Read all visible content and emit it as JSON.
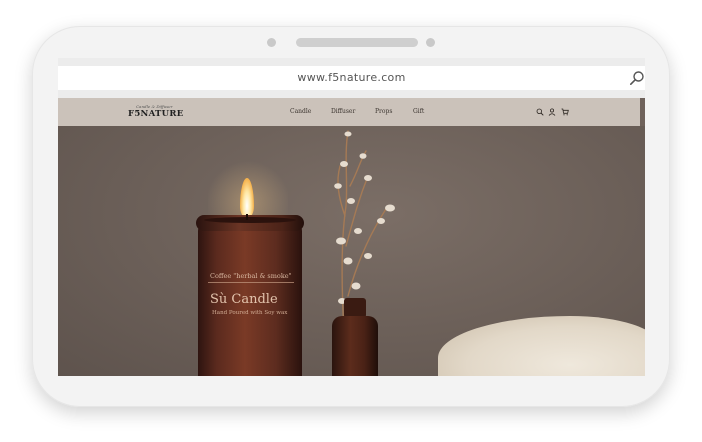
{
  "browser": {
    "url": "www.f5nature.com"
  },
  "site": {
    "logo": {
      "tagline": "Candle & Diffuser",
      "name": "F5NATURE"
    },
    "menu": [
      {
        "label": "Candle"
      },
      {
        "label": "Diffuser"
      },
      {
        "label": "Props"
      },
      {
        "label": "Gift"
      }
    ],
    "icons": [
      "search-icon",
      "user-icon",
      "cart-icon"
    ]
  },
  "hero": {
    "jar_label": {
      "subtitle": "Coffee \"herbal & smoke\"",
      "name": "Sù Candle",
      "description": "Hand Poured with Soy wax"
    }
  },
  "colors": {
    "nav_bg": "#cbc2ba",
    "wall": "#6f625b",
    "device": "#f3f3f3"
  }
}
